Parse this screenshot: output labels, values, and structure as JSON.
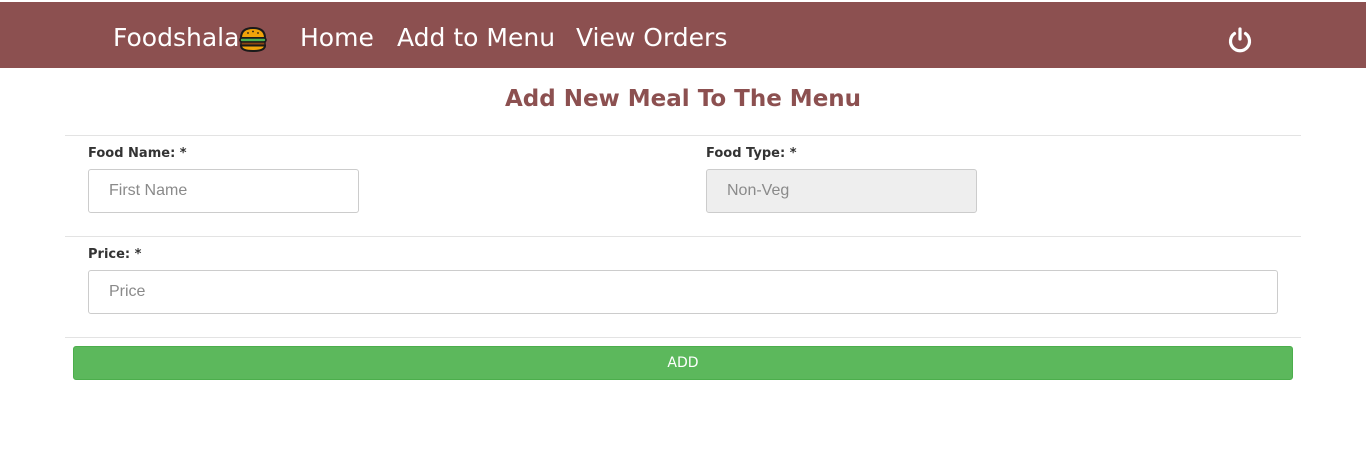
{
  "navbar": {
    "brand": "Foodshala",
    "brand_icon": "burger-icon",
    "links": {
      "home": "Home",
      "add_to_menu": "Add to Menu",
      "view_orders": "View Orders"
    },
    "logout_icon": "power-icon",
    "background_color": "#8c5050"
  },
  "form": {
    "title": "Add New Meal To The Menu",
    "food_name": {
      "label": "Food Name: *",
      "placeholder": "First Name",
      "value": ""
    },
    "food_type": {
      "label": "Food Type: *",
      "placeholder": "Non-Veg",
      "value": ""
    },
    "price": {
      "label": "Price: *",
      "placeholder": "Price",
      "value": ""
    },
    "submit_label": "ADD",
    "submit_color": "#5cb85c"
  }
}
